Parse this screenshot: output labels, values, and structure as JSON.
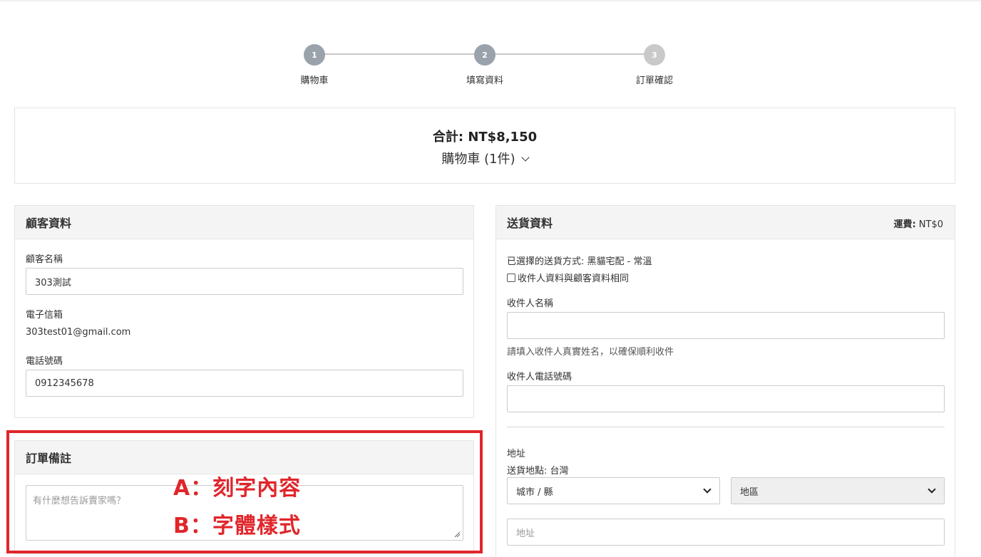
{
  "stepper": {
    "steps": [
      {
        "number": "1",
        "label": "購物車"
      },
      {
        "number": "2",
        "label": "填寫資料"
      },
      {
        "number": "3",
        "label": "訂單確認"
      }
    ]
  },
  "summary": {
    "total": "合計: NT$8,150",
    "cart": "購物車 (1件)"
  },
  "customer": {
    "title": "顧客資料",
    "name_label": "顧客名稱",
    "name_value": "303測試",
    "email_label": "電子信箱",
    "email_value": "303test01@gmail.com",
    "phone_label": "電話號碼",
    "phone_value": "0912345678"
  },
  "notes": {
    "title": "訂單備註",
    "placeholder": "有什麼想告訴賣家嗎？"
  },
  "delivery": {
    "title": "送貨資料",
    "fee_label": "運費:",
    "fee_value": "NT$0",
    "method": "已選擇的送貨方式: 黑貓宅配 - 常溫",
    "same_as_customer": "收件人資料與顧客資料相同",
    "recipient_name_label": "收件人名稱",
    "recipient_name_value": "",
    "recipient_name_hint": "請填入收件人真實姓名，以確保順利收件",
    "recipient_phone_label": "收件人電話號碼",
    "recipient_phone_value": "",
    "address_label": "地址",
    "location": "送貨地點: 台灣",
    "city_select": "城市 / 縣",
    "district_select": "地區",
    "address_placeholder": "地址"
  },
  "annotation": {
    "line_a": "A：刻字內容",
    "line_b": "B：字體樣式",
    "color": "#e0262b"
  }
}
